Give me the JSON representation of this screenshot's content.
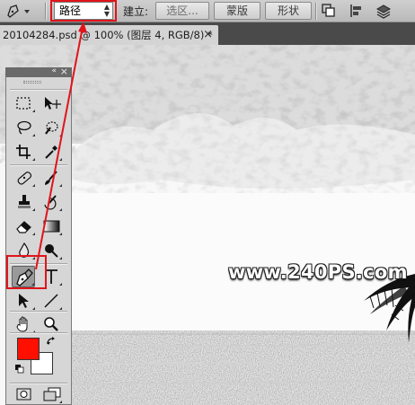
{
  "options_bar": {
    "mode_select": {
      "value": "路径"
    },
    "build_label": "建立:",
    "buttons": [
      {
        "label": "选区..."
      },
      {
        "label": "蒙版"
      },
      {
        "label": "形状"
      }
    ]
  },
  "document_tab": {
    "title": "20104284.psd @ 100% (图层 4, RGB/8) *",
    "close": "×"
  },
  "canvas": {
    "watermark": "www.240PS.com"
  },
  "tools_panel": {
    "collapse": "«",
    "close": "×",
    "foreground_color": "#ff0f00",
    "background_color": "#ffffff",
    "active_tool": "pen-tool"
  },
  "annotation": {
    "highlight_color": "#e0141b"
  }
}
